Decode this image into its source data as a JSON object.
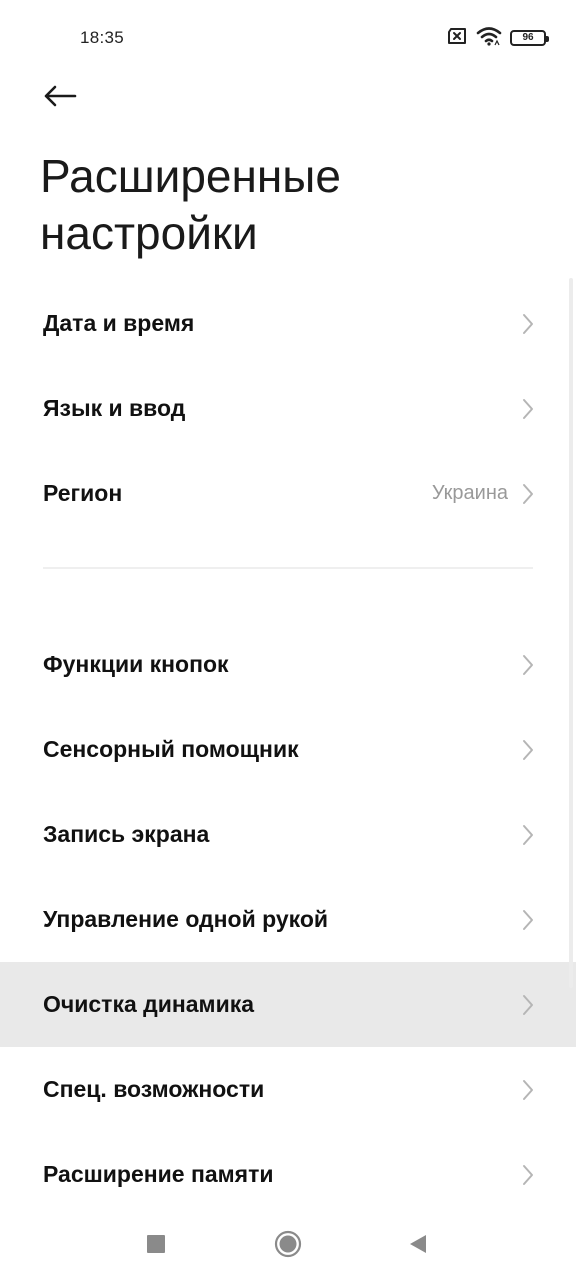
{
  "status_bar": {
    "time": "18:35",
    "battery_level": "96",
    "icons": [
      "sim-missing-icon",
      "wifi-icon",
      "battery-icon"
    ]
  },
  "header": {
    "back_icon": "arrow-left-icon",
    "title": "Расширенные настройки"
  },
  "groups": [
    {
      "items": [
        {
          "label": "Дата и время",
          "value": ""
        },
        {
          "label": "Язык и ввод",
          "value": ""
        },
        {
          "label": "Регион",
          "value": "Украина"
        }
      ]
    },
    {
      "items": [
        {
          "label": "Функции кнопок",
          "value": ""
        },
        {
          "label": "Сенсорный помощник",
          "value": ""
        },
        {
          "label": "Запись экрана",
          "value": ""
        },
        {
          "label": "Управление одной рукой",
          "value": ""
        },
        {
          "label": "Очистка динамика",
          "value": "",
          "highlighted": true
        },
        {
          "label": "Спец. возможности",
          "value": ""
        },
        {
          "label": "Расширение памяти",
          "value": ""
        }
      ]
    }
  ],
  "nav_bar": {
    "icons": [
      "recents-square-icon",
      "home-circle-icon",
      "back-triangle-icon"
    ]
  },
  "colors": {
    "highlight_row": "#e9e9e9",
    "secondary_text": "#999999",
    "chevron": "#b5b5b5"
  }
}
